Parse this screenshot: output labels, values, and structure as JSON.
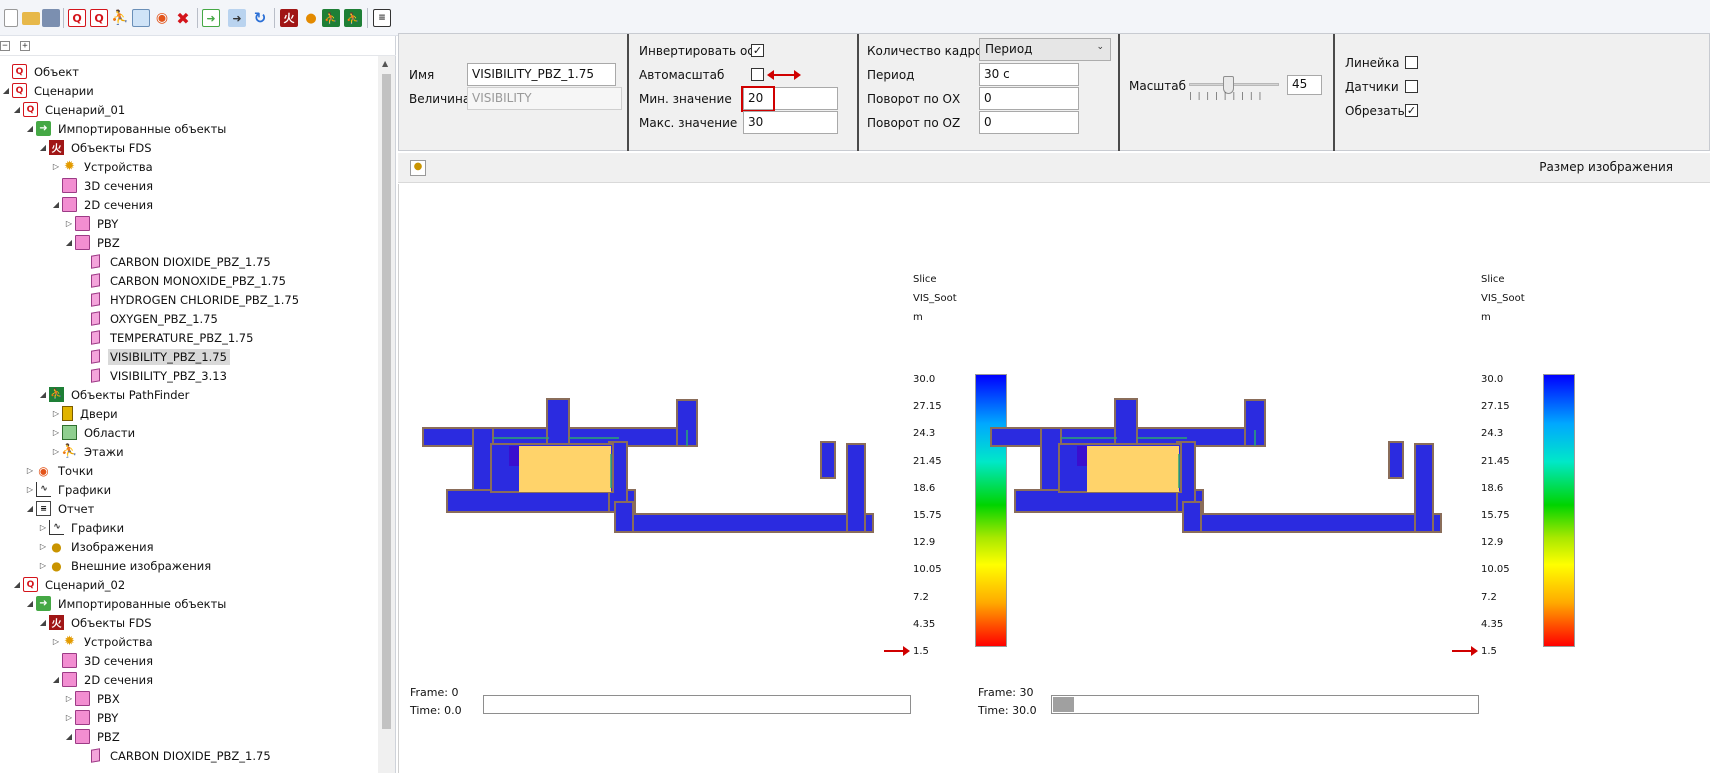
{
  "toolbar": {
    "buttons": [
      "new-file-icon",
      "open-folder-icon",
      "save-icon",
      "q-scenario-icon",
      "q-add-icon",
      "run-person-icon",
      "copy-icon",
      "add-point-icon",
      "delete-icon",
      "import-icon",
      "export-icon",
      "refresh-icon",
      "fds-icon",
      "fire-icon",
      "pathfinder-icon",
      "pathfinder-run-icon",
      "report-icon"
    ]
  },
  "tree": {
    "rows": [
      {
        "label": "Объект",
        "icon": "q",
        "level": 0,
        "exp": ""
      },
      {
        "label": "Сценарии",
        "icon": "q",
        "level": 0,
        "exp": "◢"
      },
      {
        "label": "Сценарий_01",
        "icon": "q",
        "level": 1,
        "exp": "◢"
      },
      {
        "label": "Импортированные объекты",
        "icon": "imp",
        "level": 2,
        "exp": "◢"
      },
      {
        "label": "Объекты FDS",
        "icon": "fds",
        "level": 3,
        "exp": "◢"
      },
      {
        "label": "Устройства",
        "icon": "dev",
        "level": 4,
        "exp": "▷"
      },
      {
        "label": "3D сечения",
        "icon": "slice",
        "level": 4,
        "exp": ""
      },
      {
        "label": "2D сечения",
        "icon": "slice",
        "level": 4,
        "exp": "◢"
      },
      {
        "label": "PBY",
        "icon": "slice",
        "level": 5,
        "exp": "▷"
      },
      {
        "label": "PBZ",
        "icon": "slice",
        "level": 5,
        "exp": "◢"
      },
      {
        "label": "CARBON DIOXIDE_PBZ_1.75",
        "icon": "slice-sm",
        "level": 6,
        "exp": ""
      },
      {
        "label": "CARBON MONOXIDE_PBZ_1.75",
        "icon": "slice-sm",
        "level": 6,
        "exp": ""
      },
      {
        "label": "HYDROGEN CHLORIDE_PBZ_1.75",
        "icon": "slice-sm",
        "level": 6,
        "exp": ""
      },
      {
        "label": "OXYGEN_PBZ_1.75",
        "icon": "slice-sm",
        "level": 6,
        "exp": ""
      },
      {
        "label": "TEMPERATURE_PBZ_1.75",
        "icon": "slice-sm",
        "level": 6,
        "exp": ""
      },
      {
        "label": "VISIBILITY_PBZ_1.75",
        "icon": "slice-sm",
        "level": 6,
        "exp": "",
        "selected": true
      },
      {
        "label": "VISIBILITY_PBZ_3.13",
        "icon": "slice-sm",
        "level": 6,
        "exp": ""
      },
      {
        "label": "Объекты PathFinder",
        "icon": "pf",
        "level": 3,
        "exp": "◢"
      },
      {
        "label": "Двери",
        "icon": "door",
        "level": 4,
        "exp": "▷"
      },
      {
        "label": "Области",
        "icon": "area",
        "level": 4,
        "exp": "▷"
      },
      {
        "label": "Этажи",
        "icon": "floor",
        "level": 4,
        "exp": "▷"
      },
      {
        "label": "Точки",
        "icon": "point",
        "level": 2,
        "exp": "▷"
      },
      {
        "label": "Графики",
        "icon": "graph",
        "level": 2,
        "exp": "▷"
      },
      {
        "label": "Отчет",
        "icon": "report",
        "level": 2,
        "exp": "◢"
      },
      {
        "label": "Графики",
        "icon": "graph",
        "level": 3,
        "exp": "▷"
      },
      {
        "label": "Изображения",
        "icon": "img",
        "level": 3,
        "exp": "▷"
      },
      {
        "label": "Внешние изображения",
        "icon": "img",
        "level": 3,
        "exp": "▷"
      },
      {
        "label": "Сценарий_02",
        "icon": "q",
        "level": 1,
        "exp": "◢"
      },
      {
        "label": "Импортированные объекты",
        "icon": "imp",
        "level": 2,
        "exp": "◢"
      },
      {
        "label": "Объекты FDS",
        "icon": "fds",
        "level": 3,
        "exp": "◢"
      },
      {
        "label": "Устройства",
        "icon": "dev",
        "level": 4,
        "exp": "▷"
      },
      {
        "label": "3D сечения",
        "icon": "slice",
        "level": 4,
        "exp": ""
      },
      {
        "label": "2D сечения",
        "icon": "slice",
        "level": 4,
        "exp": "◢"
      },
      {
        "label": "PBX",
        "icon": "slice",
        "level": 5,
        "exp": "▷"
      },
      {
        "label": "PBY",
        "icon": "slice",
        "level": 5,
        "exp": "▷"
      },
      {
        "label": "PBZ",
        "icon": "slice",
        "level": 5,
        "exp": "◢"
      },
      {
        "label": "CARBON DIOXIDE_PBZ_1.75",
        "icon": "slice-sm",
        "level": 6,
        "exp": ""
      }
    ]
  },
  "props": {
    "name_label": "Имя",
    "name_value": "VISIBILITY_PBZ_1.75",
    "quantity_label": "Величина",
    "quantity_value": "VISIBILITY",
    "invert_label": "Инвертировать ось",
    "invert_checked": "✓",
    "autoscale_label": "Автомасштаб",
    "autoscale_checked": "",
    "min_label": "Мин. значение",
    "min_value": "20",
    "max_label": "Макс. значение",
    "max_value": "30",
    "frames_label": "Количество кадров",
    "frames_value": "Период",
    "period_label": "Период",
    "period_value": "30 с",
    "rot_ox_label": "Поворот по ОХ",
    "rot_ox_value": "0",
    "rot_oz_label": "Поворот по OZ",
    "rot_oz_value": "0",
    "scale_label": "Масштаб",
    "scale_value": "45",
    "scale_fraction": 0.45,
    "ruler_label": "Линейка",
    "ruler_checked": "",
    "sensors_label": "Датчики",
    "sensors_checked": "",
    "crop_label": "Обрезать",
    "crop_checked": "✓"
  },
  "imgbar": {
    "size_label": "Размер изображения"
  },
  "views": [
    {
      "cb_title": "Slice",
      "cb_quantity": "VIS_Soot",
      "cb_unit": "m",
      "ticks": [
        "30.0",
        "27.15",
        "24.3",
        "21.45",
        "18.6",
        "15.75",
        "12.9",
        "10.05",
        "7.2",
        "4.35",
        "1.5"
      ],
      "frame": "Frame: 0",
      "time": "Time: 0.0",
      "progress": 0.0
    },
    {
      "cb_title": "Slice",
      "cb_quantity": "VIS_Soot",
      "cb_unit": "m",
      "ticks": [
        "30.0",
        "27.15",
        "24.3",
        "21.45",
        "18.6",
        "15.75",
        "12.9",
        "10.05",
        "7.2",
        "4.35",
        "1.5"
      ],
      "frame": "Frame: 30",
      "time": "Time: 30.0",
      "progress": 0.05
    }
  ],
  "colors": {
    "plan_blue": "#2b2be0",
    "plan_room": "#ffd36a",
    "highlight": "#d00000"
  }
}
